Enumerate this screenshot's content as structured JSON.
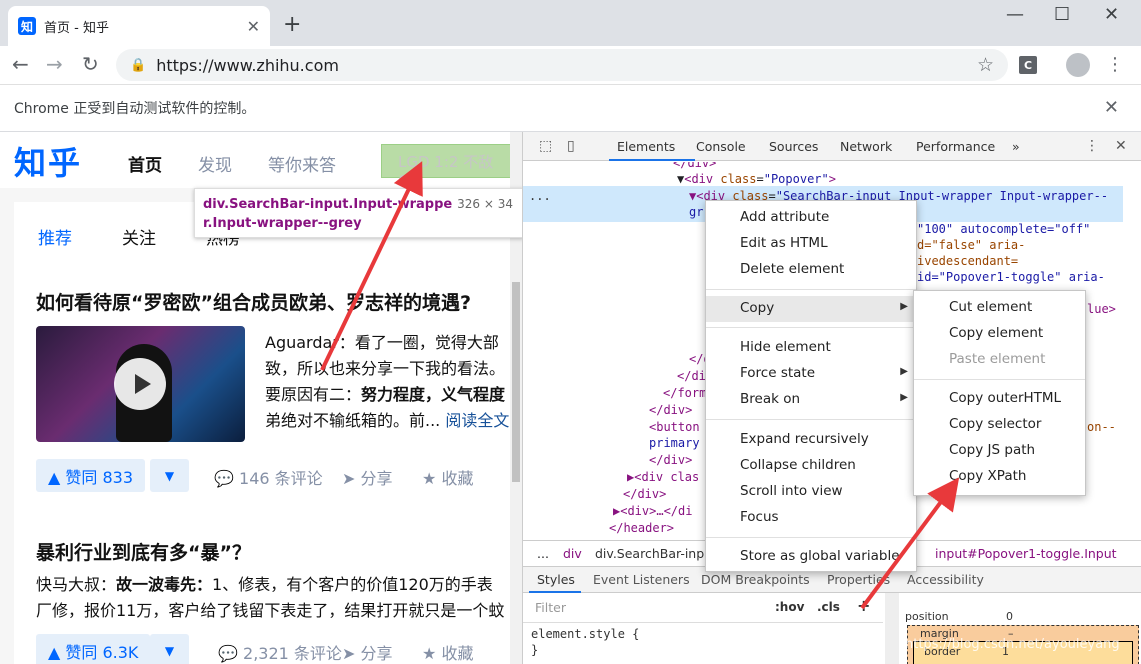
{
  "browser": {
    "tab_favicon": "知",
    "tab_title": "首页 - 知乎",
    "tab_close": "✕",
    "new_tab": "+",
    "minimize": "—",
    "maximize": "☐",
    "close": "✕",
    "url": "https://www.zhihu.com",
    "ext_label": "C",
    "infobar_message": "Chrome 正受到自动测试软件的控制。",
    "infobar_close": "✕"
  },
  "zhihu": {
    "logo": "知乎",
    "nav": [
      "首页",
      "发现",
      "等你来答"
    ],
    "search_text": "LGD 1:2 不敌 O",
    "tooltip_tag": "div.SearchBar-input.Input-wrapper.Input-wrapper--grey",
    "tooltip_size": "326 × 34",
    "feed_tabs": [
      "推荐",
      "关注",
      "热榜"
    ],
    "items": [
      {
        "title": "如何看待原“罗密欧”组合成员欧弟、罗志祥的境遇?",
        "excerpt_lines": [
          {
            "pre": "Aguardar：看了一圈，觉得大部",
            "bold": "",
            "post": ""
          },
          {
            "pre": "致，所以也来分享一下我的看法。",
            "bold": "",
            "post": ""
          },
          {
            "pre": "要原因有二：",
            "bold": "努力程度，义气程度",
            "post": ""
          },
          {
            "pre": "弟绝对不输纸箱的。前...",
            "bold": "",
            "post": ""
          }
        ],
        "read_more": "阅读全文",
        "vote": "▲ 赞同 833",
        "comments": "146 条评论",
        "share": "分享",
        "collect": "收藏"
      },
      {
        "title": "暴利行业到底有多“暴”？",
        "excerpt_lines": [
          {
            "pre": "快马大叔：",
            "bold": "故一波毒先：",
            "post": "1、修表，有个客户的价值120万的手表"
          },
          {
            "pre": "厂修，报价11万，客户给了钱留下表走了，结果打开就只是一个蚊",
            "bold": "",
            "post": ""
          }
        ],
        "vote": "▲ 赞同 6.3K",
        "comments": "2,321 条评论",
        "share": "分享",
        "collect": "收藏"
      }
    ],
    "vote_down": "▼"
  },
  "devtools": {
    "tabs": [
      "Elements",
      "Console",
      "Sources",
      "Network",
      "Performance",
      "»"
    ],
    "code": {
      "l0": "</div>",
      "l1_tag": "<div ",
      "l1_attr": "class",
      "l1_val": "\"Popover\"",
      "l1_end": ">",
      "l2_tag": "▼<div ",
      "l2_attr": "class",
      "l2_val": "\"SearchBar-input Input-wrapper Input-wrapper--",
      "l2b": "gr",
      "r1": "\"100\" autocomplete=\"off\"",
      "r2": "d=\"false\" aria-",
      "r3": "ivedescendant=",
      "r4": " id=\"Popover1-toggle\" aria-",
      "r5": "lue>",
      "r6": "on--",
      "c1": "</d",
      "c2": "</di",
      "c3": "</form",
      "c4": "</div>",
      "c5_tag": "<button",
      "c5b": "primary",
      "c6": "</div>",
      "c7": "▶<div clas",
      "c8": "</div>",
      "c9": "▶<div>…</di",
      "c10": "</header>",
      "dots": "..."
    },
    "breadcrumbs": [
      "...",
      "div",
      "div.SearchBar-inpu",
      "input#Popover1-toggle.Input"
    ],
    "styles_tabs": [
      "Styles",
      "Event Listeners",
      "DOM Breakpoints",
      "Properties",
      "Accessibility"
    ],
    "filter_placeholder": "Filter",
    "hov": ":hov",
    "cls": ".cls",
    "plus": "+",
    "element_style_1": "element.style {",
    "element_style_2": "}",
    "box_position": "position",
    "box_position_val": "0",
    "box_margin": "margin",
    "box_margin_val": "–",
    "box_border": "border",
    "box_border_val": "1"
  },
  "context_menu": {
    "items": [
      "Add attribute",
      "Edit as HTML",
      "Delete element",
      "Copy",
      "Hide element",
      "Force state",
      "Break on",
      "Expand recursively",
      "Collapse children",
      "Scroll into view",
      "Focus",
      "Store as global variable"
    ]
  },
  "copy_submenu": {
    "items": [
      "Cut element",
      "Copy element",
      "Paste element",
      "Copy outerHTML",
      "Copy selector",
      "Copy JS path",
      "Copy XPath"
    ]
  },
  "watermark": "https://blog.csdn.net/ayouleyang",
  "colors": {
    "arrow": "#e8393b",
    "zhihu_blue": "#0066ff",
    "highlight": "#b9dca6"
  }
}
